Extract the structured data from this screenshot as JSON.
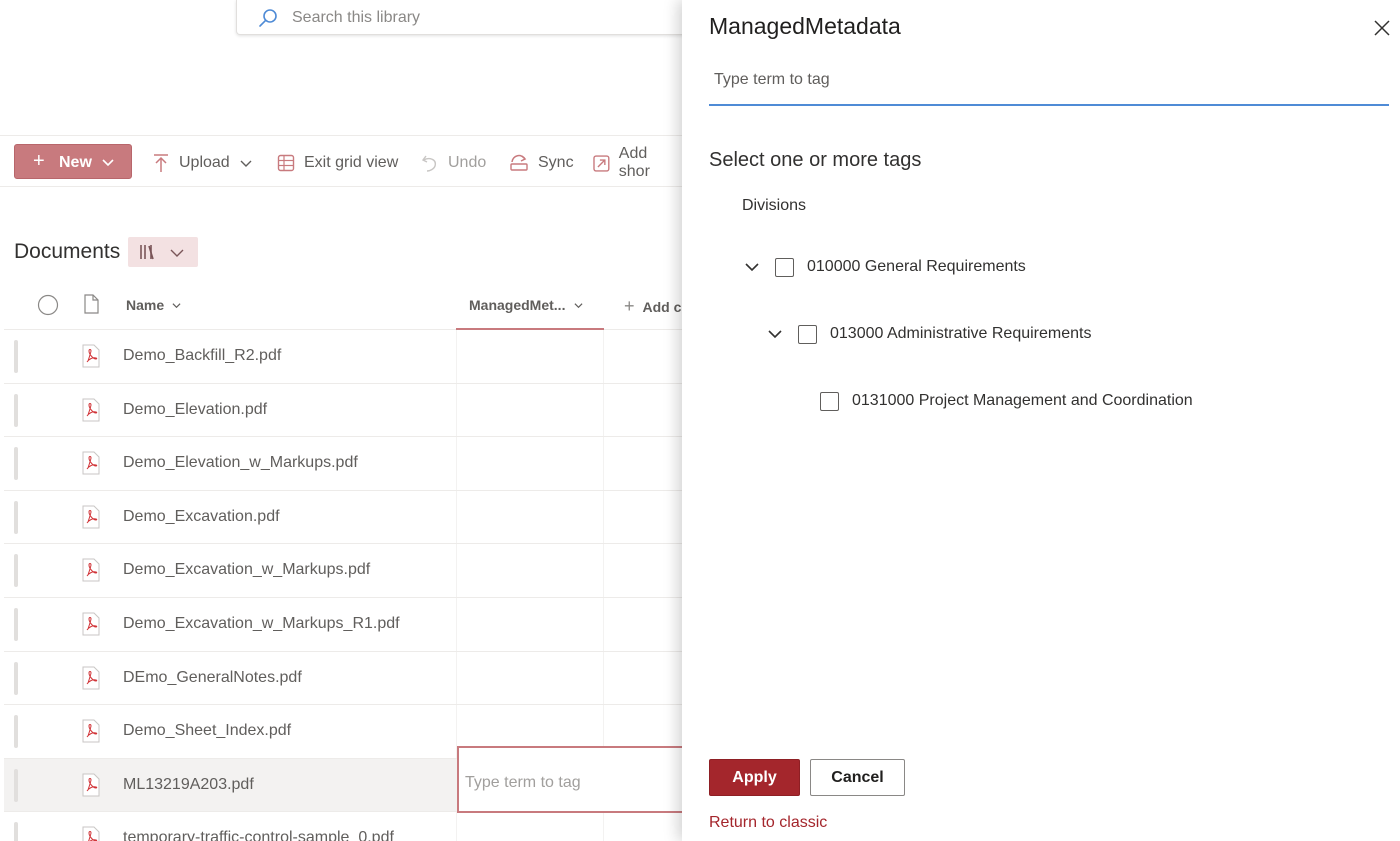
{
  "search": {
    "placeholder": "Search this library"
  },
  "toolbar": {
    "new_label": "New",
    "upload_label": "Upload",
    "exit_grid_label": "Exit grid view",
    "undo_label": "Undo",
    "sync_label": "Sync",
    "add_shortcut_label": "Add shor"
  },
  "library": {
    "title": "Documents",
    "columns": {
      "name": "Name",
      "managed": "ManagedMet...",
      "add": "Add c"
    },
    "files": [
      "Demo_Backfill_R2.pdf",
      "Demo_Elevation.pdf",
      "Demo_Elevation_w_Markups.pdf",
      "Demo_Excavation.pdf",
      "Demo_Excavation_w_Markups.pdf",
      "Demo_Excavation_w_Markups_R1.pdf",
      "DEmo_GeneralNotes.pdf",
      "Demo_Sheet_Index.pdf",
      "ML13219A203.pdf",
      "temporary-traffic-control-sample_0.pdf"
    ],
    "inline_editor_placeholder": "Type term to tag"
  },
  "panel": {
    "title": "ManagedMetadata",
    "input_placeholder": "Type term to tag",
    "select_label": "Select one or more tags",
    "group_label": "Divisions",
    "terms": [
      {
        "label": "010000 General Requirements",
        "level": 0,
        "expanded": true,
        "checked": false
      },
      {
        "label": "013000 Administrative Requirements",
        "level": 1,
        "expanded": true,
        "checked": false
      },
      {
        "label": "0131000 Project Management and Coordination",
        "level": 2,
        "expanded": false,
        "checked": false
      }
    ],
    "apply_label": "Apply",
    "cancel_label": "Cancel",
    "classic_link": "Return to classic"
  },
  "colors": {
    "accent": "#a4262c",
    "accent_light": "#c87a7e",
    "focus_blue": "#4f8bd6"
  }
}
